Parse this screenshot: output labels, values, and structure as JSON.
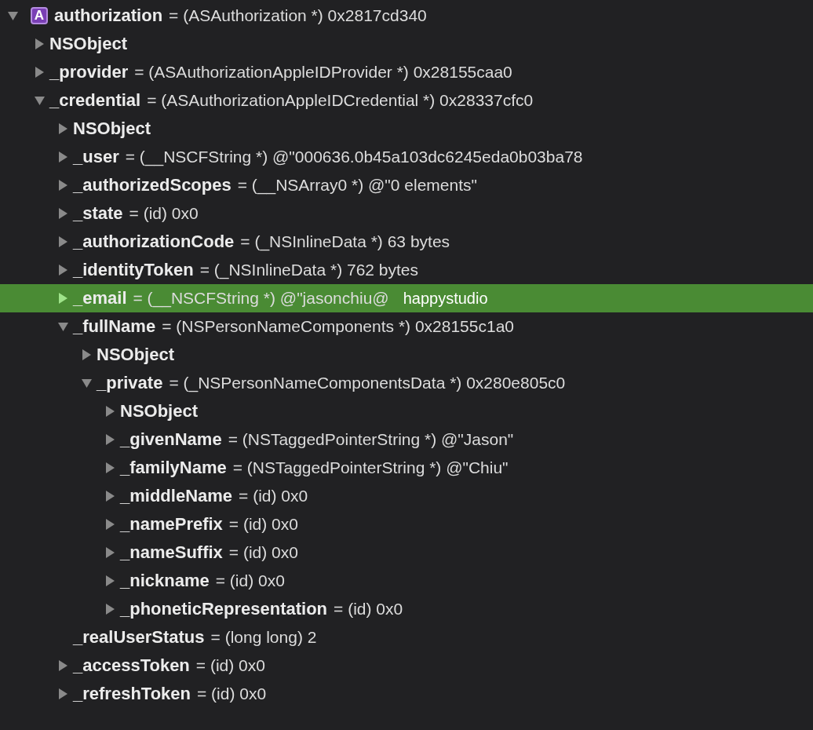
{
  "variables": [
    {
      "name": "authorization",
      "value": "= (ASAuthorization *) 0x2817cd340",
      "badge": "A",
      "expanded": true,
      "selected": false,
      "children": [
        {
          "name": "NSObject",
          "expanded": false,
          "selected": false
        },
        {
          "name": "_provider",
          "value": "= (ASAuthorizationAppleIDProvider *) 0x28155caa0",
          "expanded": false,
          "selected": false
        },
        {
          "name": "_credential",
          "value": "= (ASAuthorizationAppleIDCredential *) 0x28337cfc0",
          "expanded": true,
          "selected": false,
          "children": [
            {
              "name": "NSObject",
              "expanded": false,
              "selected": false
            },
            {
              "name": "_user",
              "value": "= (__NSCFString *) @\"000636.0b45a103dc6245eda0b03ba78",
              "expanded": false,
              "selected": false
            },
            {
              "name": "_authorizedScopes",
              "value": "= (__NSArray0 *) @\"0 elements\"",
              "expanded": false,
              "selected": false
            },
            {
              "name": "_state",
              "value": "= (id) 0x0",
              "expanded": false,
              "selected": false
            },
            {
              "name": "_authorizationCode",
              "value": "= (_NSInlineData *) 63 bytes",
              "expanded": false,
              "selected": false
            },
            {
              "name": "_identityToken",
              "value": "= (_NSInlineData *) 762 bytes",
              "expanded": false,
              "selected": false
            },
            {
              "name": "_email",
              "value": "= (__NSCFString *) @\"jasonchiu@",
              "note": "happystudio",
              "expanded": false,
              "selected": true
            },
            {
              "name": "_fullName",
              "value": "= (NSPersonNameComponents *) 0x28155c1a0",
              "expanded": true,
              "selected": false,
              "children": [
                {
                  "name": "NSObject",
                  "expanded": false,
                  "selected": false
                },
                {
                  "name": "_private",
                  "value": "= (_NSPersonNameComponentsData *) 0x280e805c0",
                  "expanded": true,
                  "selected": false,
                  "children": [
                    {
                      "name": "NSObject",
                      "expanded": false,
                      "selected": false
                    },
                    {
                      "name": "_givenName",
                      "value": "= (NSTaggedPointerString *) @\"Jason\"",
                      "expanded": false,
                      "selected": false
                    },
                    {
                      "name": "_familyName",
                      "value": "= (NSTaggedPointerString *) @\"Chiu\"",
                      "expanded": false,
                      "selected": false
                    },
                    {
                      "name": "_middleName",
                      "value": "= (id) 0x0",
                      "expanded": false,
                      "selected": false
                    },
                    {
                      "name": "_namePrefix",
                      "value": "= (id) 0x0",
                      "expanded": false,
                      "selected": false
                    },
                    {
                      "name": "_nameSuffix",
                      "value": "= (id) 0x0",
                      "expanded": false,
                      "selected": false
                    },
                    {
                      "name": "_nickname",
                      "value": "= (id) 0x0",
                      "expanded": false,
                      "selected": false
                    },
                    {
                      "name": "_phoneticRepresentation",
                      "value": "= (id) 0x0",
                      "expanded": false,
                      "selected": false
                    }
                  ]
                }
              ]
            },
            {
              "name": "_realUserStatus",
              "value": "= (long long) 2",
              "selected": false
            },
            {
              "name": "_accessToken",
              "value": "= (id) 0x0",
              "expanded": false,
              "selected": false
            },
            {
              "name": "_refreshToken",
              "value": "= (id) 0x0",
              "expanded": false,
              "selected": false
            }
          ]
        }
      ]
    }
  ]
}
